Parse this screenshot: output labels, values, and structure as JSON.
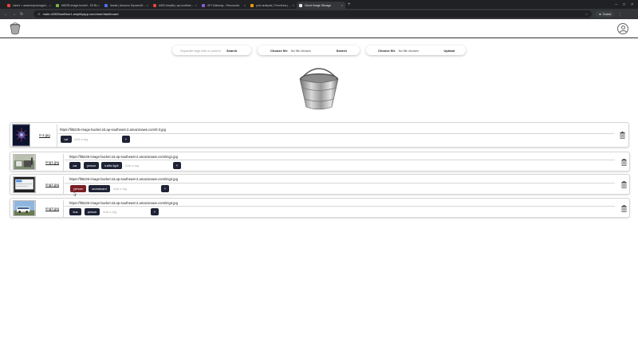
{
  "browser": {
    "tabs": [
      {
        "label": "Users < awsmeepstorage4211",
        "color": "#e8453c",
        "active": false
      },
      {
        "label": "fit5225-image-bucket - S3 Bu",
        "color": "#7cb342",
        "active": false
      },
      {
        "label": "Assist | Amazon DynamoDB M",
        "color": "#4f6ef7",
        "active": false
      },
      {
        "label": "AWS Amplify | ap-southeast-2",
        "color": "#e8453c",
        "active": false
      },
      {
        "label": "API Gateway - Resources",
        "color": "#8e5bd6",
        "active": false
      },
      {
        "label": "yolo-analysis | Functions | Lam",
        "color": "#f29900",
        "active": false
      },
      {
        "label": "Cloud Image Storage",
        "color": "#e8eaed",
        "active": true
      }
    ],
    "url": "main.d2525ws8hon1.amplifyapp.com/user/dashboard",
    "profile_label": "Guest"
  },
  "search": {
    "placeholder": "Separate tags with a comma",
    "button": "Search"
  },
  "file_search": {
    "choose_label": "Choose file",
    "file_status": "No file chosen",
    "button": "Search"
  },
  "upload": {
    "choose_label": "Choose file",
    "file_status": "No file chosen",
    "button": "Upload"
  },
  "add_tag_placeholder": "Add a tag",
  "add_button": "+",
  "images": [
    {
      "name": "0-3.jpg",
      "url": "https://fit5225-image-bucket.s3.ap-southeast-2.amazonaws.com/0-3.jpg",
      "tags": [
        "car"
      ]
    },
    {
      "name": "img1.jpg",
      "url": "https://fit5225-image-bucket.s3.ap-southeast-2.amazonaws.com/img1.jpg",
      "tags": [
        "car",
        "person",
        "traffic light"
      ]
    },
    {
      "name": "img2.jpg",
      "url": "https://fit5225-image-bucket.s3.ap-southeast-2.amazonaws.com/img2.jpg",
      "tags": [
        "person",
        "snowboard"
      ]
    },
    {
      "name": "img3.jpg",
      "url": "https://fit5225-image-bucket.s3.ap-southeast-2.amazonaws.com/img3.jpg",
      "tags": [
        "bus",
        "person"
      ]
    }
  ]
}
